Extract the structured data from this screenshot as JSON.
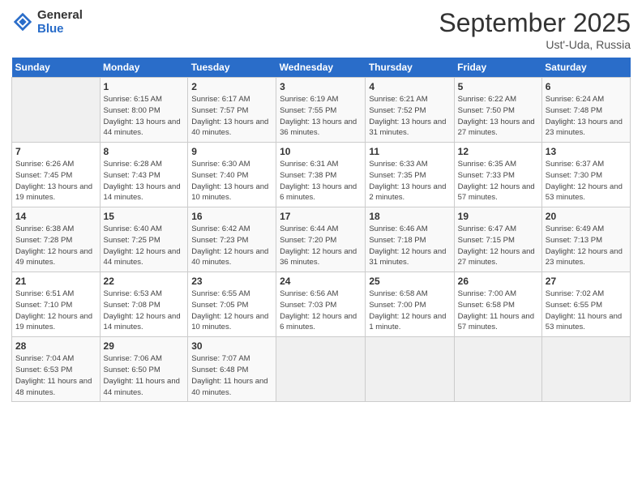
{
  "logo": {
    "general": "General",
    "blue": "Blue"
  },
  "title": "September 2025",
  "subtitle": "Ust'-Uda, Russia",
  "headers": [
    "Sunday",
    "Monday",
    "Tuesday",
    "Wednesday",
    "Thursday",
    "Friday",
    "Saturday"
  ],
  "weeks": [
    [
      {
        "num": "",
        "info": ""
      },
      {
        "num": "1",
        "info": "Sunrise: 6:15 AM\nSunset: 8:00 PM\nDaylight: 13 hours and 44 minutes."
      },
      {
        "num": "2",
        "info": "Sunrise: 6:17 AM\nSunset: 7:57 PM\nDaylight: 13 hours and 40 minutes."
      },
      {
        "num": "3",
        "info": "Sunrise: 6:19 AM\nSunset: 7:55 PM\nDaylight: 13 hours and 36 minutes."
      },
      {
        "num": "4",
        "info": "Sunrise: 6:21 AM\nSunset: 7:52 PM\nDaylight: 13 hours and 31 minutes."
      },
      {
        "num": "5",
        "info": "Sunrise: 6:22 AM\nSunset: 7:50 PM\nDaylight: 13 hours and 27 minutes."
      },
      {
        "num": "6",
        "info": "Sunrise: 6:24 AM\nSunset: 7:48 PM\nDaylight: 13 hours and 23 minutes."
      }
    ],
    [
      {
        "num": "7",
        "info": "Sunrise: 6:26 AM\nSunset: 7:45 PM\nDaylight: 13 hours and 19 minutes."
      },
      {
        "num": "8",
        "info": "Sunrise: 6:28 AM\nSunset: 7:43 PM\nDaylight: 13 hours and 14 minutes."
      },
      {
        "num": "9",
        "info": "Sunrise: 6:30 AM\nSunset: 7:40 PM\nDaylight: 13 hours and 10 minutes."
      },
      {
        "num": "10",
        "info": "Sunrise: 6:31 AM\nSunset: 7:38 PM\nDaylight: 13 hours and 6 minutes."
      },
      {
        "num": "11",
        "info": "Sunrise: 6:33 AM\nSunset: 7:35 PM\nDaylight: 13 hours and 2 minutes."
      },
      {
        "num": "12",
        "info": "Sunrise: 6:35 AM\nSunset: 7:33 PM\nDaylight: 12 hours and 57 minutes."
      },
      {
        "num": "13",
        "info": "Sunrise: 6:37 AM\nSunset: 7:30 PM\nDaylight: 12 hours and 53 minutes."
      }
    ],
    [
      {
        "num": "14",
        "info": "Sunrise: 6:38 AM\nSunset: 7:28 PM\nDaylight: 12 hours and 49 minutes."
      },
      {
        "num": "15",
        "info": "Sunrise: 6:40 AM\nSunset: 7:25 PM\nDaylight: 12 hours and 44 minutes."
      },
      {
        "num": "16",
        "info": "Sunrise: 6:42 AM\nSunset: 7:23 PM\nDaylight: 12 hours and 40 minutes."
      },
      {
        "num": "17",
        "info": "Sunrise: 6:44 AM\nSunset: 7:20 PM\nDaylight: 12 hours and 36 minutes."
      },
      {
        "num": "18",
        "info": "Sunrise: 6:46 AM\nSunset: 7:18 PM\nDaylight: 12 hours and 31 minutes."
      },
      {
        "num": "19",
        "info": "Sunrise: 6:47 AM\nSunset: 7:15 PM\nDaylight: 12 hours and 27 minutes."
      },
      {
        "num": "20",
        "info": "Sunrise: 6:49 AM\nSunset: 7:13 PM\nDaylight: 12 hours and 23 minutes."
      }
    ],
    [
      {
        "num": "21",
        "info": "Sunrise: 6:51 AM\nSunset: 7:10 PM\nDaylight: 12 hours and 19 minutes."
      },
      {
        "num": "22",
        "info": "Sunrise: 6:53 AM\nSunset: 7:08 PM\nDaylight: 12 hours and 14 minutes."
      },
      {
        "num": "23",
        "info": "Sunrise: 6:55 AM\nSunset: 7:05 PM\nDaylight: 12 hours and 10 minutes."
      },
      {
        "num": "24",
        "info": "Sunrise: 6:56 AM\nSunset: 7:03 PM\nDaylight: 12 hours and 6 minutes."
      },
      {
        "num": "25",
        "info": "Sunrise: 6:58 AM\nSunset: 7:00 PM\nDaylight: 12 hours and 1 minute."
      },
      {
        "num": "26",
        "info": "Sunrise: 7:00 AM\nSunset: 6:58 PM\nDaylight: 11 hours and 57 minutes."
      },
      {
        "num": "27",
        "info": "Sunrise: 7:02 AM\nSunset: 6:55 PM\nDaylight: 11 hours and 53 minutes."
      }
    ],
    [
      {
        "num": "28",
        "info": "Sunrise: 7:04 AM\nSunset: 6:53 PM\nDaylight: 11 hours and 48 minutes."
      },
      {
        "num": "29",
        "info": "Sunrise: 7:06 AM\nSunset: 6:50 PM\nDaylight: 11 hours and 44 minutes."
      },
      {
        "num": "30",
        "info": "Sunrise: 7:07 AM\nSunset: 6:48 PM\nDaylight: 11 hours and 40 minutes."
      },
      {
        "num": "",
        "info": ""
      },
      {
        "num": "",
        "info": ""
      },
      {
        "num": "",
        "info": ""
      },
      {
        "num": "",
        "info": ""
      }
    ]
  ]
}
